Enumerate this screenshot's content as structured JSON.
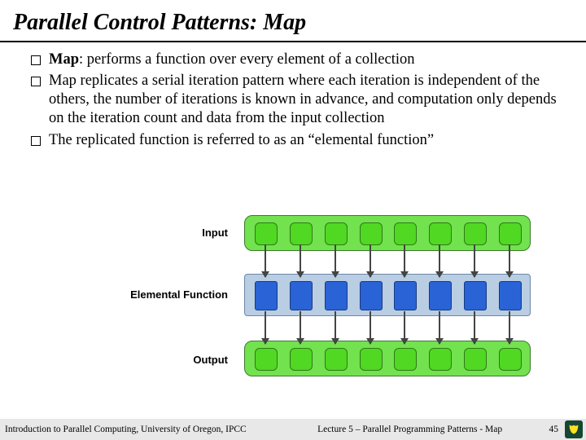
{
  "title": "Parallel Control Patterns: Map",
  "bullets": [
    {
      "bold": "Map",
      "rest": ": performs a function over every element of a collection"
    },
    {
      "bold": "",
      "rest": "Map replicates a serial iteration pattern where each iteration is independent of the others, the number of iterations is known in advance, and computation only depends on the iteration count and data from the input collection"
    },
    {
      "bold": "",
      "rest": "The replicated function is referred to as an “elemental function”"
    }
  ],
  "diagram": {
    "labels": {
      "input": "Input",
      "ef": "Elemental Function",
      "output": "Output"
    },
    "lanes": 8
  },
  "footer": {
    "left": "Introduction to Parallel Computing, University of Oregon, IPCC",
    "center": "Lecture 5 – Parallel Programming Patterns - Map",
    "page": "45"
  }
}
